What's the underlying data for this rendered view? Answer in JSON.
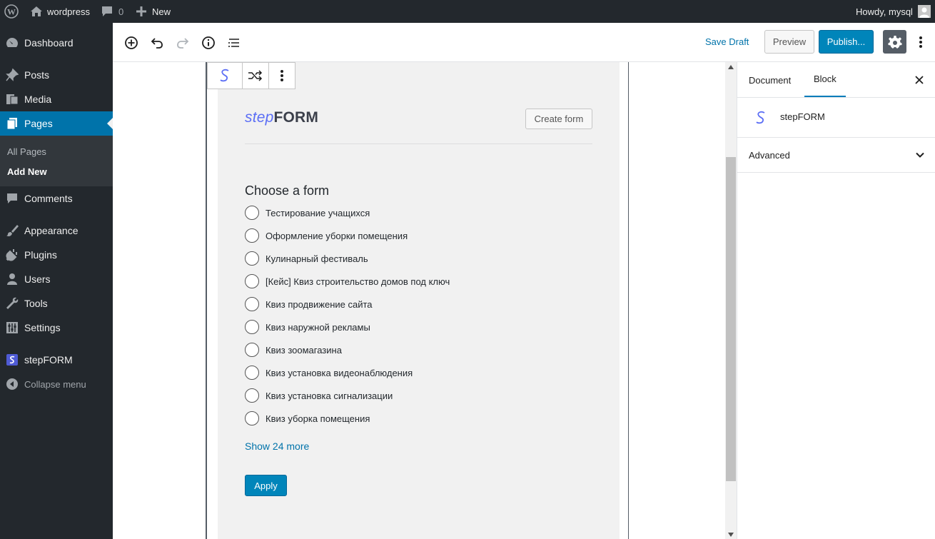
{
  "adminbar": {
    "site_name": "wordpress",
    "comments_count": "0",
    "new_label": "New",
    "greeting": "Howdy, mysql"
  },
  "sidebar": {
    "items": [
      {
        "label": "Dashboard",
        "icon": "dashboard-icon"
      },
      {
        "label": "Posts",
        "icon": "pushpin-icon"
      },
      {
        "label": "Media",
        "icon": "media-icon"
      },
      {
        "label": "Pages",
        "icon": "pages-icon"
      },
      {
        "label": "Comments",
        "icon": "comment-icon"
      },
      {
        "label": "Appearance",
        "icon": "paintbrush-icon"
      },
      {
        "label": "Plugins",
        "icon": "plugin-icon"
      },
      {
        "label": "Users",
        "icon": "user-icon"
      },
      {
        "label": "Tools",
        "icon": "wrench-icon"
      },
      {
        "label": "Settings",
        "icon": "sliders-icon"
      },
      {
        "label": "stepFORM",
        "icon": "stepform-icon"
      },
      {
        "label": "Collapse menu",
        "icon": "collapse-icon"
      }
    ],
    "submenu": [
      "All Pages",
      "Add New"
    ]
  },
  "header": {
    "save_draft": "Save Draft",
    "preview": "Preview",
    "publish": "Publish..."
  },
  "block": {
    "logo_step": "step",
    "logo_form": "FORM",
    "create_form": "Create form",
    "title": "Choose a form",
    "options": [
      "Тестирование учащихся",
      "Оформление уборки помещения",
      "Кулинарный фестиваль",
      "[Кейс] Квиз строительство домов под ключ",
      "Квиз продвижение сайта",
      "Квиз наружной рекламы",
      "Квиз зоомагазина",
      "Квиз установка видеонаблюдения",
      "Квиз установка сигнализации",
      "Квиз уборка помещения"
    ],
    "show_more": "Show 24 more",
    "apply": "Apply"
  },
  "settings_panel": {
    "tabs": [
      "Document",
      "Block"
    ],
    "active_tab": "Block",
    "block_name": "stepFORM",
    "advanced": "Advanced"
  },
  "colors": {
    "accent": "#0073aa",
    "primary_button": "#0085ba",
    "admin_dark": "#23282d",
    "stepform_blue": "#5b6ef5"
  }
}
